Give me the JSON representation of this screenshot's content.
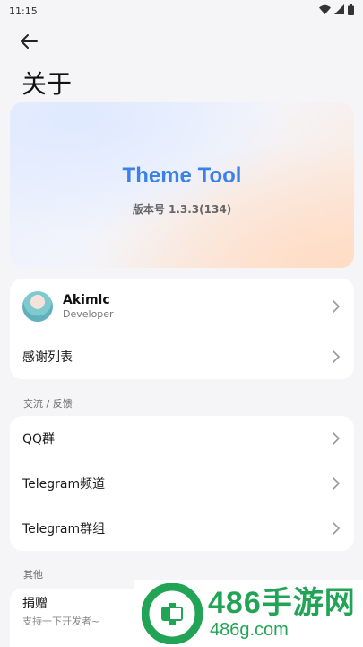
{
  "status_bar": {
    "time": "11:15",
    "icons": [
      "wifi-icon",
      "signal-icon",
      "battery-icon"
    ]
  },
  "header": {
    "back_icon": "arrow-left-icon",
    "title": "关于"
  },
  "hero": {
    "app_name": "Theme Tool",
    "version": "版本号 1.3.3(134)",
    "accent": "#3b82e8"
  },
  "developer_card": {
    "name": "Akimlc",
    "role": "Developer",
    "thanks_label": "感谢列表"
  },
  "feedback_section": {
    "header": "交流 / 反馈",
    "items": [
      {
        "label": "QQ群"
      },
      {
        "label": "Telegram频道"
      },
      {
        "label": "Telegram群组"
      }
    ]
  },
  "other_section": {
    "header": "其他",
    "donate_title": "捐赠",
    "donate_sub": "支持一下开发者~"
  },
  "watermark": {
    "big": "486手游网",
    "small": "486g.com",
    "color": "#21a455"
  }
}
